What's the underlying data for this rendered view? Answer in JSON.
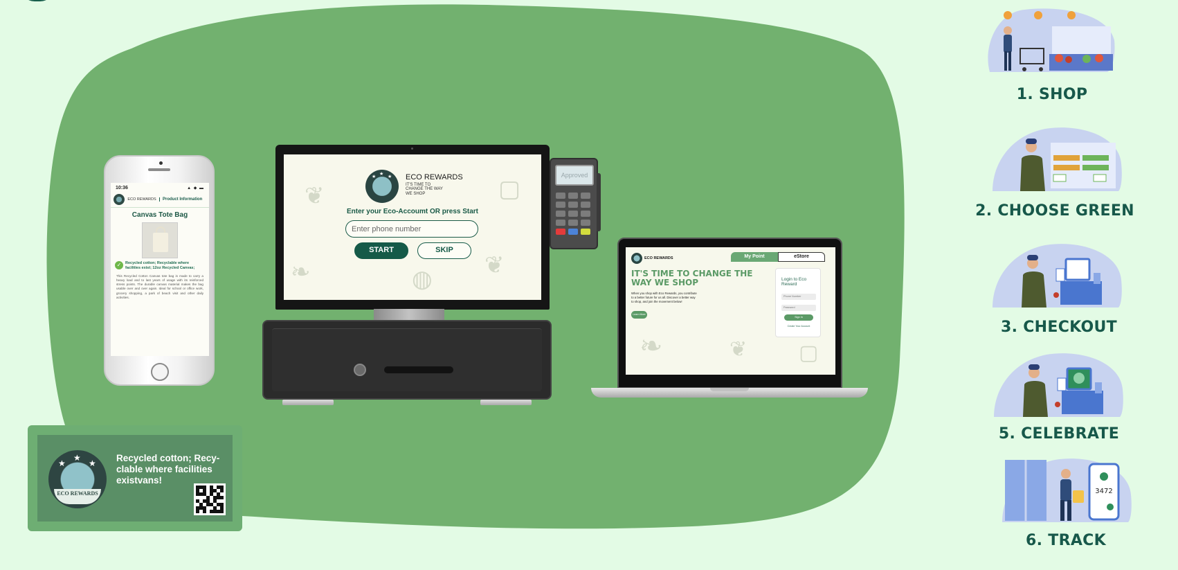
{
  "phone": {
    "time": "10:36",
    "signal": "▲ ◆ ▬",
    "brand": "ECO REWARDS",
    "tab": "Product Information",
    "product_title": "Canvas Tote Bag",
    "materials": "Recycled cotton; Recyclable where facilities exist; 12oz Recycled Canvas;",
    "description": "This Recycled Cotton Canvas tote bag is made to carry a heavy load and to last years of usage with its reinforced stress points. The durable canvas material makes the bag usable over and over again. Ideal for school or office work, grocery shopping, a park of beach visit and other daily activities."
  },
  "pos": {
    "brand": "ECO REWARDS",
    "tagline": "IT'S TIME TO CHANGE THE WAY WE SHOP",
    "prompt": "Enter your Eco-Accoumt OR press Start",
    "phone_placeholder": "Enter phone number",
    "start_label": "START",
    "skip_label": "SKIP"
  },
  "terminal": {
    "status": "Approved"
  },
  "laptop": {
    "brand": "ECO REWARDS",
    "tab_points": "My Point",
    "tab_store": "eStore",
    "headline": "IT'S TIME TO CHANGE THE WAY WE SHOP",
    "body": "When you shop with Eco Rewards, you contribute to a better future for us all. Discover a better way to shop, and join the movement below!",
    "learn_more": "Learn More",
    "login_title": "Login to Eco Reward",
    "phone_field": "Phone Number",
    "password_field": "Password",
    "sign_in": "Sign In",
    "create_account": "Create Your Account"
  },
  "label": {
    "logo_text": "ECO REWARDS",
    "text": "Recycled cotton; Recy-clable where facilities existvans!"
  },
  "steps": [
    {
      "label": "1. SHOP"
    },
    {
      "label": "2. CHOOSE GREEN"
    },
    {
      "label": "3. CHECKOUT"
    },
    {
      "label": "5. CELEBRATE"
    },
    {
      "label": "6. TRACK"
    }
  ],
  "colors": {
    "background": "#e3fbe5",
    "blob": "#72b16f",
    "brand_dark": "#17584a"
  },
  "icons": [
    "eco-rewards-logo",
    "check-icon",
    "qr-code"
  ]
}
